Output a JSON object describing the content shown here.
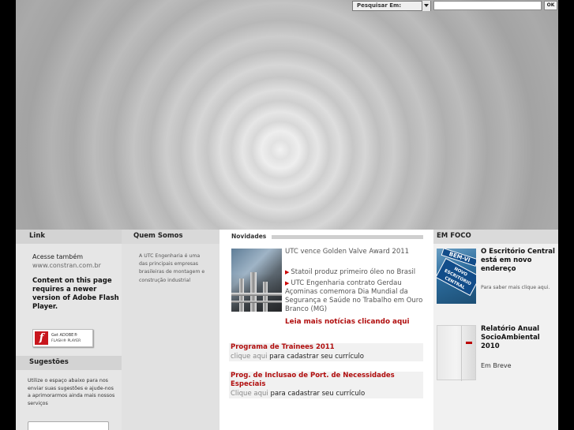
{
  "search": {
    "select_label": "Pesquisar Em:",
    "ok_label": "OK"
  },
  "link": {
    "heading": "Link",
    "acesse": "Acesse também",
    "url": "www.constran.com.br",
    "flash_message": "Content on this page requires a newer version of Adobe Flash Player.",
    "flash_badge_get": "Get ADOBE®",
    "flash_badge_player": "FLASH® PLAYER"
  },
  "sugestoes": {
    "heading": "Sugestões",
    "text": "Utilize o espaço abaixo para nos enviar suas sugestões e ajude-nos a aprimorarmos ainda mais nossos serviços"
  },
  "quem_somos": {
    "heading": "Quem Somos",
    "text": "A UTC Engenharia é uma das principais empresas brasileiras de montagem e construção industrial"
  },
  "novidades": {
    "heading": "Novidades",
    "headline": "UTC vence Golden Valve Award 2011",
    "items": [
      "Statoil produz primeiro óleo no Brasil",
      "UTC Engenharia contrato Gerdau Açominas comemora Dia Mundial da Segurança e Saúde no Trabalho em Ouro Branco (MG)"
    ],
    "more": "Leia mais notícias clicando aqui",
    "promos": [
      {
        "title": "Programa de Trainees 2011",
        "link": "clique aqui",
        "rest": "para cadastrar seu currículo"
      },
      {
        "title": "Prog. de Inclusao de Port. de Necessidades Especiais",
        "link": "Clique aqui",
        "rest": "para cadastrar seu currículo"
      }
    ]
  },
  "em_foco": {
    "heading": "EM FOCO",
    "item1_title": "O Escritório Central está em novo endereço",
    "item1_sub": "Para saber mais clique aqui.",
    "item1_sign_top": "BEM-VI",
    "item1_sign_bottom": "NOVO ESCRITÓRIO CENTRAL",
    "item2_title": "Relatório Anual SocioAmbiental 2010",
    "item2_sub": "Em Breve"
  }
}
